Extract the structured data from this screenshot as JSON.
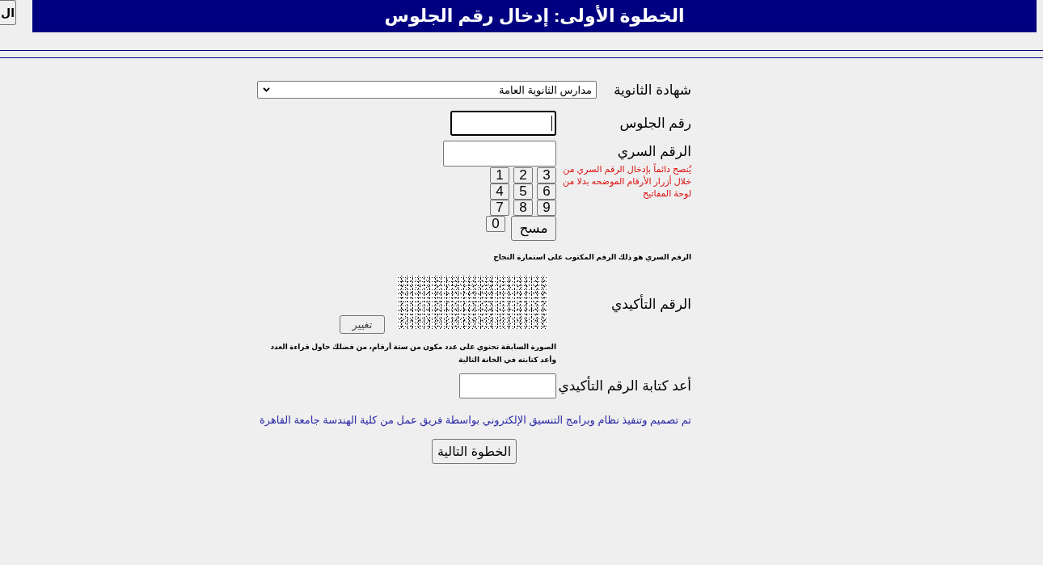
{
  "top_button": {
    "label": "ال"
  },
  "header": {
    "title": "الخطوة الأولى: إدخال رقم الجلوس"
  },
  "form": {
    "certificate": {
      "label": "شهادة الثانوية",
      "value": "مدارس الثانوية العامة"
    },
    "seat_number": {
      "label": "رقم الجلوس",
      "focused": true
    },
    "secret_number": {
      "label": "الرقم السري",
      "focused": false,
      "hint": "يُنصح دائماً بإدخال الرقم السري من خلال أزرار الأرقام الموضحه بدلا من لوحة المفاتيح",
      "keys": [
        "3",
        "2",
        "1",
        "6",
        "5",
        "4",
        "9",
        "8",
        "7",
        "0"
      ],
      "clear_button": "مسح"
    },
    "secret_note": "الرقم السري هو ذلك الرقم المكتوب على استمارة النجاح",
    "confirmation": {
      "label": "الرقم التأكيدي",
      "change_button": "تغيير",
      "note": "الصورة السابقة تحتوي على عدد مكون من ستة أرقام، من فضلك حاول قراءة العدد وأعد كتابته في الخانة التالية"
    },
    "confirmation_repeat": {
      "label": "أعد كتابة الرقم التأكيدي",
      "focused": false
    },
    "credits": "تم تصميم وتنفيذ نظام وبرامج التنسيق الإلكتروني بواسطة فريق عمل من كلية الهندسة جامعة القاهرة",
    "next_button": "الخطوة التالية"
  }
}
